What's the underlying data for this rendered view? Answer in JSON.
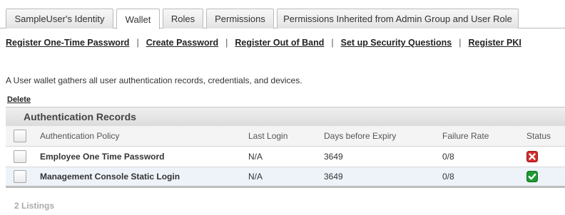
{
  "tabs": [
    {
      "label": "SampleUser's Identity"
    },
    {
      "label": "Wallet",
      "active": true
    },
    {
      "label": "Roles"
    },
    {
      "label": "Permissions"
    },
    {
      "label": "Permissions Inherited from Admin Group and User Role"
    }
  ],
  "actions": [
    {
      "label": "Register One-Time Password"
    },
    {
      "label": "Create Password"
    },
    {
      "label": "Register Out of Band"
    },
    {
      "label": "Set up Security Questions"
    },
    {
      "label": "Register PKI"
    }
  ],
  "separator": "|",
  "description": "A User wallet gathers all user authentication records, credentials, and devices.",
  "delete_label": "Delete",
  "table": {
    "title": "Authentication Records",
    "columns": {
      "policy": "Authentication Policy",
      "last_login": "Last Login",
      "days_before_expiry": "Days before Expiry",
      "failure_rate": "Failure Rate",
      "status": "Status"
    },
    "rows": [
      {
        "policy": "Employee One Time Password",
        "last_login": "N/A",
        "days_before_expiry": "3649",
        "failure_rate": "0/8",
        "status": "disabled",
        "status_icon": "red-x-icon",
        "status_color": "#d42b2b"
      },
      {
        "policy": "Management Console Static Login",
        "last_login": "N/A",
        "days_before_expiry": "3649",
        "failure_rate": "0/8",
        "status": "enabled",
        "status_icon": "green-check-icon",
        "status_color": "#1e9a33"
      }
    ],
    "listing_count": "2 Listings"
  }
}
